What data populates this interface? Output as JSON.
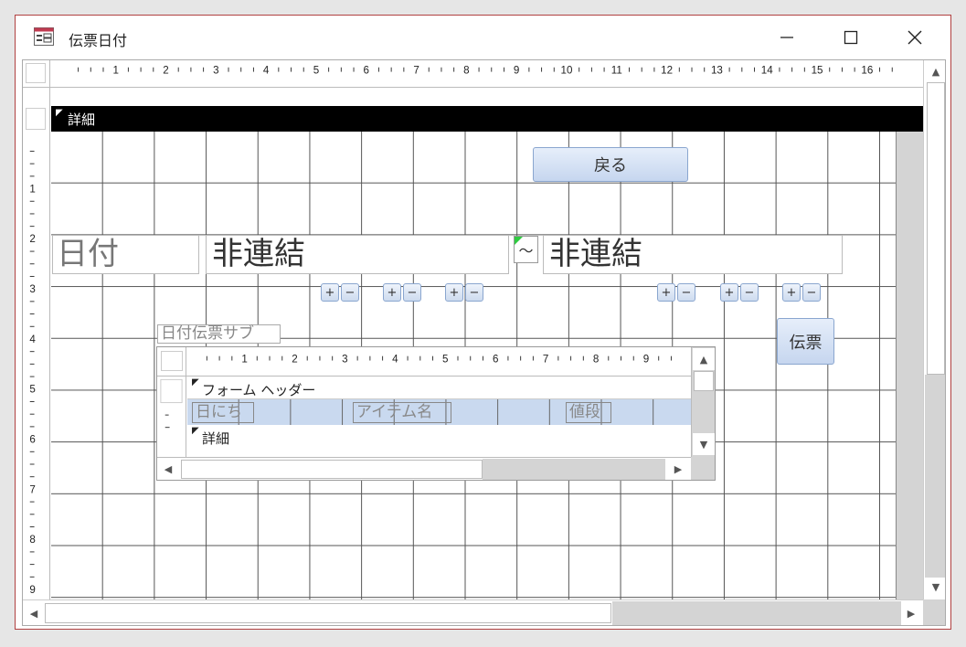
{
  "window": {
    "title": "伝票日付"
  },
  "ruler": {
    "horizontal_ticks": [
      "1",
      "2",
      "3",
      "4",
      "5",
      "6",
      "7",
      "8",
      "9",
      "10",
      "11",
      "12",
      "13",
      "14",
      "15",
      "16"
    ],
    "vertical_ticks": [
      "1",
      "2",
      "3",
      "4",
      "5",
      "6",
      "7",
      "8",
      "9"
    ]
  },
  "section": {
    "detail_label": "詳細"
  },
  "controls": {
    "back_button": "戻る",
    "date_label": "日付",
    "unbound_from": "非連結",
    "tilde": "～",
    "unbound_to": "非連結",
    "plus": "+",
    "minus": "−",
    "voucher_button": "伝票"
  },
  "subform": {
    "label": "日付伝票サブ",
    "ruler_ticks": [
      "1",
      "2",
      "3",
      "4",
      "5",
      "6",
      "7",
      "8",
      "9"
    ],
    "form_header_label": "フォーム ヘッダー",
    "detail_label": "詳細",
    "fields": [
      "日にち",
      "アイテム名",
      "値段"
    ]
  },
  "colors": {
    "window_border": "#b04040",
    "section_bar": "#000000",
    "selected_row": "#c9d9ef",
    "button_accent": "#8aa6cf"
  }
}
